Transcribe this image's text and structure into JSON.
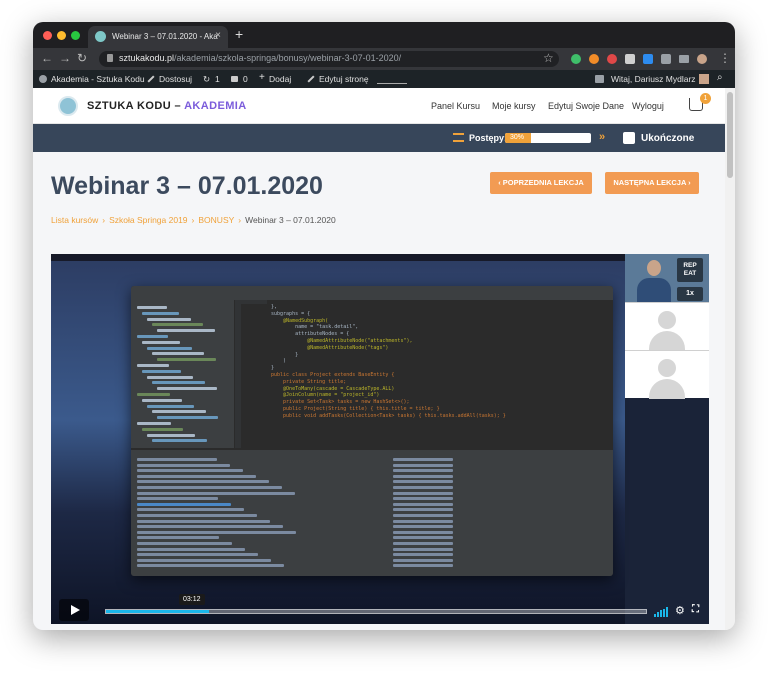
{
  "browser": {
    "tab_title": "Webinar 3 – 07.01.2020 - Aka",
    "tab_close": "×",
    "new_tab": "+",
    "url_domain": "sztukakodu.pl",
    "url_path": "/akademia/szkola-springa/bonusy/webinar-3-07-01-2020/"
  },
  "admin_bar": {
    "site": "Akademia - Sztuka Kodu",
    "customize": "Dostosuj",
    "updates_count": "1",
    "comments_count": "0",
    "add_new": "Dodaj",
    "edit_page": "Edytuj stronę",
    "greeting": "Witaj, Dariusz Mydlarz"
  },
  "header": {
    "brand_main": "SZTUKA KODU – ",
    "brand_accent": "AKADEMIA",
    "menu": [
      "Panel Kursu",
      "Moje kursy",
      "Edytuj Swoje Dane",
      "Wyloguj"
    ],
    "cart_count": "1"
  },
  "progress": {
    "label": "Postępy:",
    "percent_label": "30%",
    "percent_value": 0.3,
    "arrows": "»",
    "completed_label": "Ukończone"
  },
  "lesson": {
    "title": "Webinar 3 – 07.01.2020",
    "prev_button": "‹  POPRZEDNIA LEKCJA",
    "next_button": "NASTĘPNA LEKCJA  ›"
  },
  "breadcrumbs": {
    "items": [
      "Lista kursów",
      "Szkoła Springa 2019",
      "BONUSY"
    ],
    "current": "Webinar 3 – 07.01.2020",
    "separator": "›"
  },
  "video": {
    "current_time": "03:12",
    "played_fraction": 0.19,
    "repeat_label": "REP EAT",
    "speed_label": "1x",
    "code_lines": [
      "},",
      "subgraphs = {",
      "    @NamedSubgraph(",
      "        name = \"task.detail\",",
      "        attributeNodes = {",
      "            @NamedAttributeNode(\"attachments\"),",
      "            @NamedAttributeNode(\"tags\")",
      "        }",
      "    )",
      "}",
      "public class Project extends BaseEntity {",
      "    private String title;",
      "",
      "    @OneToMany(cascade = CascadeType.ALL)",
      "    @JoinColumn(name = \"project_id\")",
      "    private Set<Task> tasks = new HashSet<>();",
      "",
      "    public Project(String title) { this.title = title; }",
      "",
      "    public void addTasks(Collection<Task> tasks) { this.tasks.addAll(tasks); }"
    ]
  },
  "colors": {
    "accent_orange": "#f0a23a",
    "brand_purple": "#7b5cdb",
    "band_navy": "#37465a",
    "title_slate": "#3c4a5e",
    "video_seek": "#1ab7ea"
  },
  "icons": {
    "close": "×",
    "back": "←",
    "forward": "→",
    "reload": "↻",
    "star": "☆",
    "gear": "⚙",
    "fullscreen": "⛶",
    "menu_dots": "⋮",
    "search": "⌕"
  }
}
